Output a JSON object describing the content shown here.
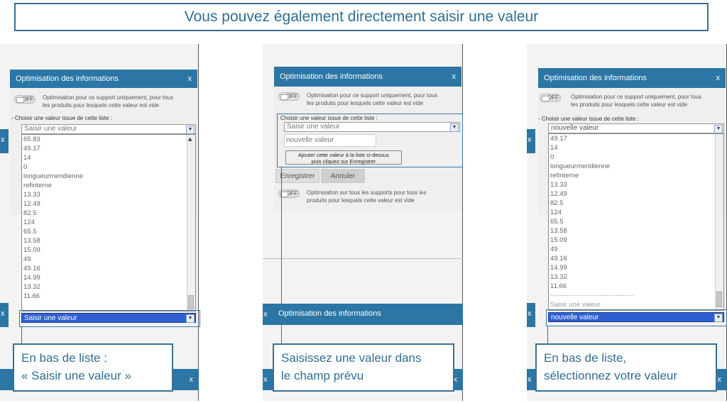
{
  "header": {
    "title": "Vous pouvez également directement saisir une valeur"
  },
  "dialog": {
    "title": "Optimisation des informations",
    "close": "x",
    "toggle_off": "OFF",
    "opt_support_line1": "Optimisation pour ce support uniquement, pour tous",
    "opt_support_line2": "les produits pour lesquels cette valeur est vide",
    "choose_label": "- Choisir une valeur issue de cette liste :",
    "placeholder_select": "Saisir une valeur",
    "opt_all_line1": "Optimisation sur tous les supports pour tous les",
    "opt_all_line2": "produits pour lesquels cette valeur est vide"
  },
  "panel1": {
    "list": [
      "65.83",
      "49.17",
      "14",
      "0",
      "longueurmeridienne",
      "refinterne",
      "13.33",
      "12.49",
      "82.5",
      "124",
      "65.5",
      "13.58",
      "15.09",
      "49",
      "49.16",
      "14.99",
      "13.32",
      "11.66"
    ],
    "selected": "Saisir une valeur",
    "callout_line1": "En bas de liste :",
    "callout_line2": "« Saisir une valeur »"
  },
  "panel2": {
    "input_value": "nouvelle valeur",
    "add_button_line1": "Ajouter cette valeur à la liste ci-dessus",
    "add_button_line2": "puis cliquez sur Enregistrer",
    "save": "Enregistrer",
    "cancel": "Annuler",
    "callout_line1": "Saisissez une valeur dans",
    "callout_line2": "le champ prévu"
  },
  "panel3": {
    "select_value": "nouvelle valeur",
    "list": [
      "49.17",
      "14",
      "0",
      "longueurmeridienne",
      "refinterne",
      "13.33",
      "12.49",
      "82.5",
      "124",
      "65.5",
      "13.58",
      "15.09",
      "49",
      "49.16",
      "14.99",
      "13.32",
      "11.66"
    ],
    "separator": "-------------------------------------",
    "faded_item": "Saisir une valeur",
    "selected": "nouvelle valeur",
    "callout_line1": "En bas de liste,",
    "callout_line2": "sélectionnez votre valeur"
  },
  "colors": {
    "accent": "#2b76a5",
    "title_text": "#2f6e95",
    "selection": "#2f5fd0"
  }
}
